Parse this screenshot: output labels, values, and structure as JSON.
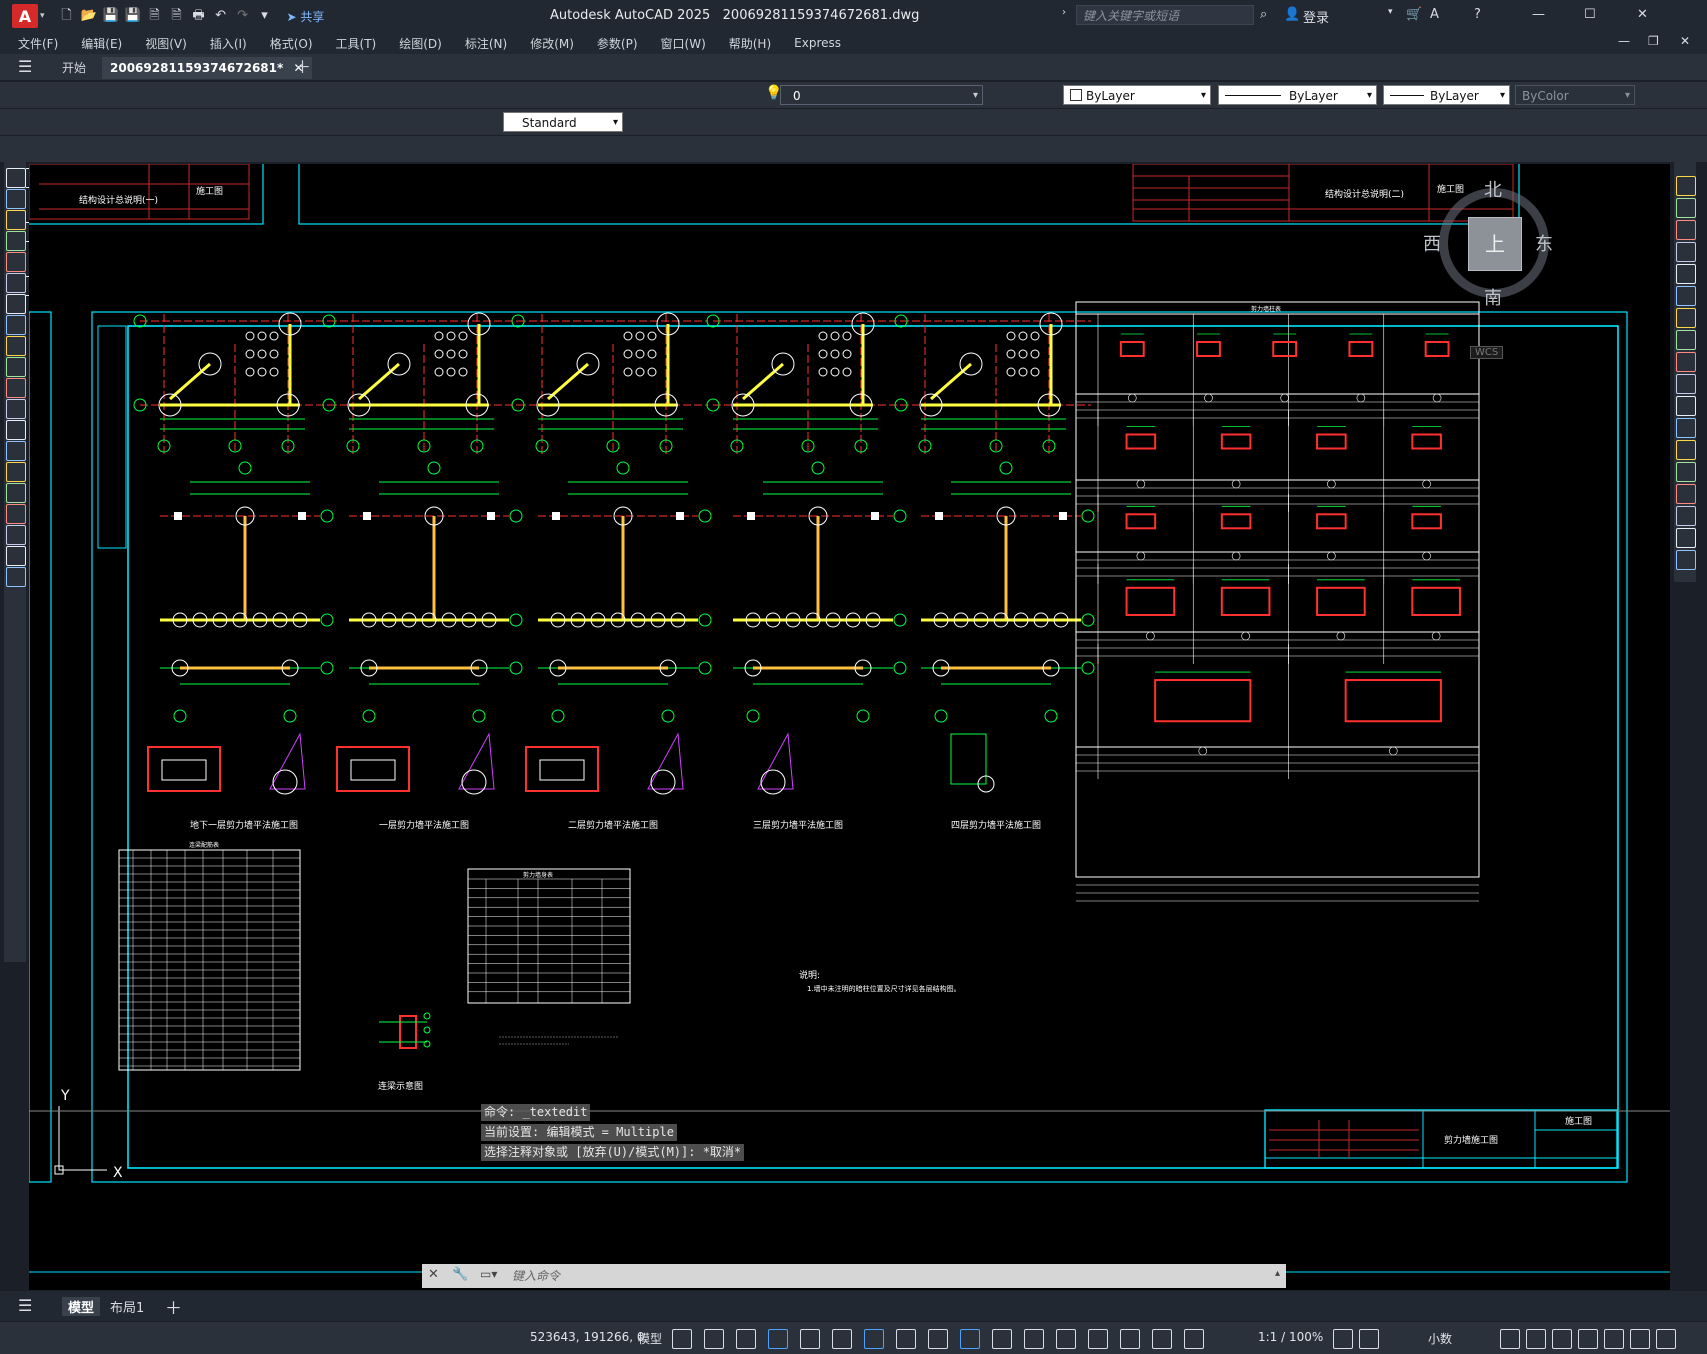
{
  "app": {
    "logo_letter": "A",
    "title": "Autodesk AutoCAD 2025",
    "file": "20069281159374672681.dwg",
    "share": "共享",
    "search_placeholder": "键入关键字或短语",
    "login": "登录"
  },
  "menu": [
    "文件(F)",
    "编辑(E)",
    "视图(V)",
    "插入(I)",
    "格式(O)",
    "工具(T)",
    "绘图(D)",
    "标注(N)",
    "修改(M)",
    "参数(P)",
    "窗口(W)",
    "帮助(H)",
    "Express"
  ],
  "tabs": {
    "start": "开始",
    "doc": "20069281159374672681*"
  },
  "properties": {
    "layer": "0",
    "color": "ByLayer",
    "linetype": "ByLayer",
    "lineweight": "ByLayer",
    "plotstyle": "ByColor",
    "textstyle": "Standard"
  },
  "viewcube": {
    "north": "北",
    "south": "南",
    "east": "东",
    "west": "西",
    "face": "上",
    "wcs": "WCS"
  },
  "drawing": {
    "top_left_title": "结构设计总说明(一)",
    "top_left_stage": "施工图",
    "top_right_title": "结构设计总说明(二)",
    "top_right_stage": "施工图",
    "plans": [
      "地下一层剪力墙平法施工图",
      "一层剪力墙平法施工图",
      "二层剪力墙平法施工图",
      "三层剪力墙平法施工图",
      "四层剪力墙平法施工图"
    ],
    "table1_title": "连梁配筋表",
    "table2_title": "剪力墙身表",
    "detail_title": "连梁示意图",
    "notes_head": "说明:",
    "notes_line": "1.墙中未注明的暗柱位置及尺寸详见各层结构图。",
    "schedule_title": "剪力墙柱表",
    "titleblock_name": "剪力墙施工图",
    "titleblock_stage": "施工图"
  },
  "command": {
    "line1": "命令: _textedit",
    "line2": "当前设置: 编辑模式 = Multiple",
    "line3": "选择注释对象或 [放弃(U)/模式(M)]: *取消*",
    "placeholder": "键入命令"
  },
  "layouts": {
    "model": "模型",
    "layout1": "布局1"
  },
  "status": {
    "coords": "523643, 191266, 0",
    "mode": "模型",
    "scale": "1:1 / 100%",
    "units": "小数"
  }
}
